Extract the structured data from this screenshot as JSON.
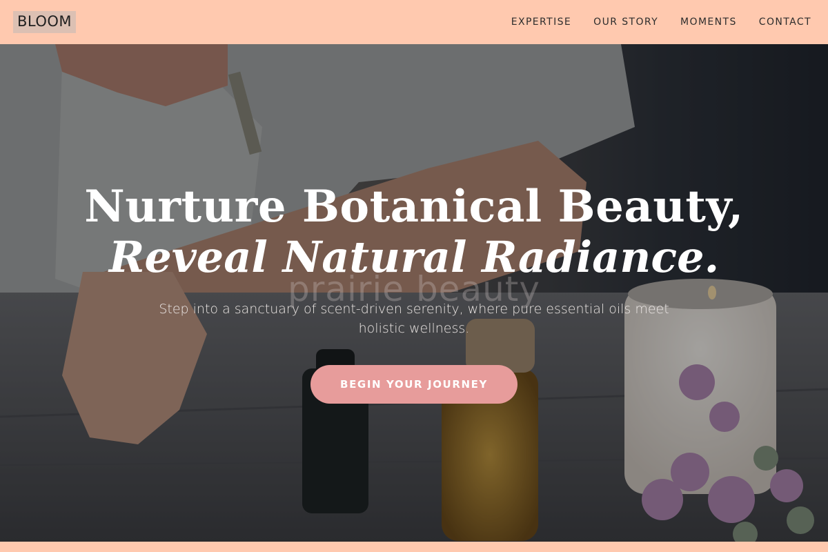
{
  "header": {
    "logo": "BLOOM",
    "nav": [
      "EXPERTISE",
      "OUR STORY",
      "MOMENTS",
      "CONTACT"
    ]
  },
  "hero": {
    "headline_line1": "Nurture Botanical Beauty,",
    "headline_line2": "Reveal Natural Radiance.",
    "watermark": "prairie beauty",
    "subtitle": "Step into a sanctuary of scent-driven serenity, where pure essential oils meet holistic wellness.",
    "cta_label": "BEGIN YOUR JOURNEY"
  },
  "colors": {
    "header_bg": "#ffc9af",
    "cta_bg": "#e79c9b",
    "logo_bg": "#dcc0b3"
  }
}
